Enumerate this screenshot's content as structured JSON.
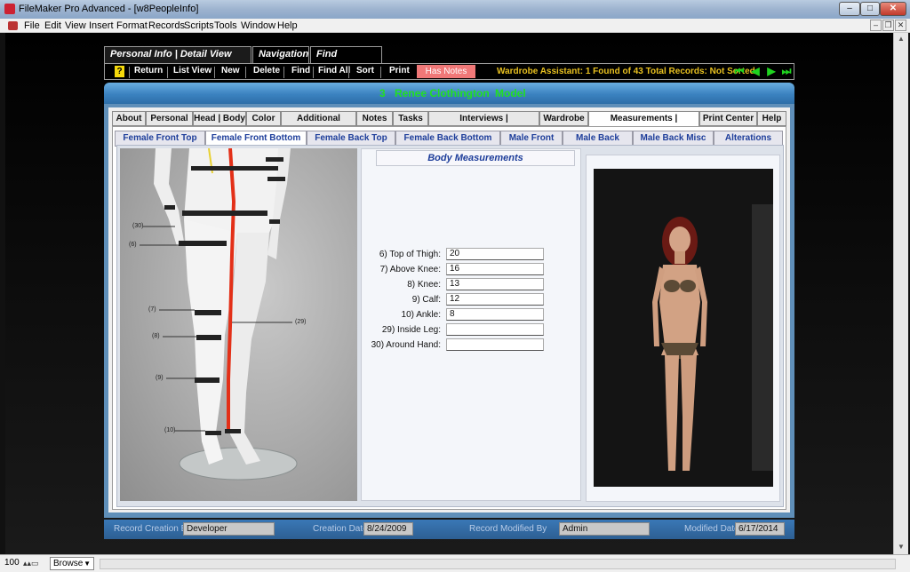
{
  "window": {
    "title": "FileMaker Pro Advanced - [w8PeopleInfo]"
  },
  "menu": [
    "File",
    "Edit",
    "View",
    "Insert",
    "Format",
    "Records",
    "Scripts",
    "Tools",
    "Window",
    "Help"
  ],
  "toolbar_tabs": [
    "Personal Info | Detail View Toolbar",
    "Navigation",
    "Find Functions"
  ],
  "toolbar": {
    "help": "?",
    "buttons": [
      "Return",
      "List View",
      "New",
      "Delete",
      "Find",
      "Find All",
      "Sort",
      "Print"
    ],
    "has_notes": "Has Notes",
    "assistant": "Wardrobe Assistant:  1 Found of 43 Total Records: Not Sorted"
  },
  "record": {
    "id": "3",
    "name": "Renee Clothington",
    "role": "Model"
  },
  "tabs": [
    "About",
    "Personal",
    "Head | Body",
    "Color",
    "Additional Images",
    "Notes",
    "Tasks",
    "Interviews | Questionnaires",
    "Wardrobe",
    "Measurements | Alterations",
    "Print Center",
    "Help"
  ],
  "subtabs": [
    "Female Front Top",
    "Female Front Bottom",
    "Female Back Top",
    "Female Back Bottom",
    "Male Front",
    "Male Back",
    "Male Back Misc",
    "Alterations"
  ],
  "body_measurements": {
    "title": "Body Measurements",
    "fields": [
      {
        "label": "6)  Top of Thigh:",
        "value": "20"
      },
      {
        "label": "7)  Above Knee:",
        "value": "16"
      },
      {
        "label": "8)  Knee:",
        "value": "13"
      },
      {
        "label": "9)  Calf:",
        "value": "12"
      },
      {
        "label": "10)  Ankle:",
        "value": "8"
      },
      {
        "label": "29)  Inside Leg:",
        "value": ""
      },
      {
        "label": "30)  Around Hand:",
        "value": ""
      }
    ]
  },
  "diagram_labels": [
    "(30)",
    "(6)",
    "(7)",
    "(8)",
    "(9)",
    "(10)",
    "(29)"
  ],
  "footer": {
    "created_by_label": "Record Creation By",
    "created_by": "Developer",
    "creation_date_label": "Creation Date",
    "creation_date": "8/24/2009",
    "modified_by_label": "Record Modified By",
    "modified_by": "Admin",
    "modified_date_label": "Modified Date",
    "modified_date": "6/17/2014"
  },
  "status": {
    "zoom": "100",
    "mode": "Browse"
  }
}
